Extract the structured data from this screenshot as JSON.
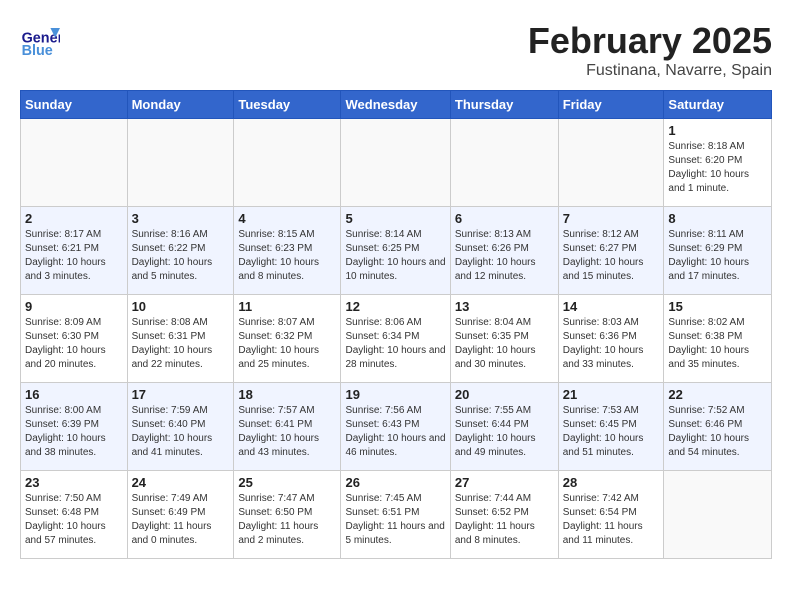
{
  "header": {
    "logo_general": "General",
    "logo_blue": "Blue",
    "month_title": "February 2025",
    "location": "Fustinana, Navarre, Spain"
  },
  "days_of_week": [
    "Sunday",
    "Monday",
    "Tuesday",
    "Wednesday",
    "Thursday",
    "Friday",
    "Saturday"
  ],
  "weeks": [
    [
      {
        "day": "",
        "info": ""
      },
      {
        "day": "",
        "info": ""
      },
      {
        "day": "",
        "info": ""
      },
      {
        "day": "",
        "info": ""
      },
      {
        "day": "",
        "info": ""
      },
      {
        "day": "",
        "info": ""
      },
      {
        "day": "1",
        "info": "Sunrise: 8:18 AM\nSunset: 6:20 PM\nDaylight: 10 hours and 1 minute."
      }
    ],
    [
      {
        "day": "2",
        "info": "Sunrise: 8:17 AM\nSunset: 6:21 PM\nDaylight: 10 hours and 3 minutes."
      },
      {
        "day": "3",
        "info": "Sunrise: 8:16 AM\nSunset: 6:22 PM\nDaylight: 10 hours and 5 minutes."
      },
      {
        "day": "4",
        "info": "Sunrise: 8:15 AM\nSunset: 6:23 PM\nDaylight: 10 hours and 8 minutes."
      },
      {
        "day": "5",
        "info": "Sunrise: 8:14 AM\nSunset: 6:25 PM\nDaylight: 10 hours and 10 minutes."
      },
      {
        "day": "6",
        "info": "Sunrise: 8:13 AM\nSunset: 6:26 PM\nDaylight: 10 hours and 12 minutes."
      },
      {
        "day": "7",
        "info": "Sunrise: 8:12 AM\nSunset: 6:27 PM\nDaylight: 10 hours and 15 minutes."
      },
      {
        "day": "8",
        "info": "Sunrise: 8:11 AM\nSunset: 6:29 PM\nDaylight: 10 hours and 17 minutes."
      }
    ],
    [
      {
        "day": "9",
        "info": "Sunrise: 8:09 AM\nSunset: 6:30 PM\nDaylight: 10 hours and 20 minutes."
      },
      {
        "day": "10",
        "info": "Sunrise: 8:08 AM\nSunset: 6:31 PM\nDaylight: 10 hours and 22 minutes."
      },
      {
        "day": "11",
        "info": "Sunrise: 8:07 AM\nSunset: 6:32 PM\nDaylight: 10 hours and 25 minutes."
      },
      {
        "day": "12",
        "info": "Sunrise: 8:06 AM\nSunset: 6:34 PM\nDaylight: 10 hours and 28 minutes."
      },
      {
        "day": "13",
        "info": "Sunrise: 8:04 AM\nSunset: 6:35 PM\nDaylight: 10 hours and 30 minutes."
      },
      {
        "day": "14",
        "info": "Sunrise: 8:03 AM\nSunset: 6:36 PM\nDaylight: 10 hours and 33 minutes."
      },
      {
        "day": "15",
        "info": "Sunrise: 8:02 AM\nSunset: 6:38 PM\nDaylight: 10 hours and 35 minutes."
      }
    ],
    [
      {
        "day": "16",
        "info": "Sunrise: 8:00 AM\nSunset: 6:39 PM\nDaylight: 10 hours and 38 minutes."
      },
      {
        "day": "17",
        "info": "Sunrise: 7:59 AM\nSunset: 6:40 PM\nDaylight: 10 hours and 41 minutes."
      },
      {
        "day": "18",
        "info": "Sunrise: 7:57 AM\nSunset: 6:41 PM\nDaylight: 10 hours and 43 minutes."
      },
      {
        "day": "19",
        "info": "Sunrise: 7:56 AM\nSunset: 6:43 PM\nDaylight: 10 hours and 46 minutes."
      },
      {
        "day": "20",
        "info": "Sunrise: 7:55 AM\nSunset: 6:44 PM\nDaylight: 10 hours and 49 minutes."
      },
      {
        "day": "21",
        "info": "Sunrise: 7:53 AM\nSunset: 6:45 PM\nDaylight: 10 hours and 51 minutes."
      },
      {
        "day": "22",
        "info": "Sunrise: 7:52 AM\nSunset: 6:46 PM\nDaylight: 10 hours and 54 minutes."
      }
    ],
    [
      {
        "day": "23",
        "info": "Sunrise: 7:50 AM\nSunset: 6:48 PM\nDaylight: 10 hours and 57 minutes."
      },
      {
        "day": "24",
        "info": "Sunrise: 7:49 AM\nSunset: 6:49 PM\nDaylight: 11 hours and 0 minutes."
      },
      {
        "day": "25",
        "info": "Sunrise: 7:47 AM\nSunset: 6:50 PM\nDaylight: 11 hours and 2 minutes."
      },
      {
        "day": "26",
        "info": "Sunrise: 7:45 AM\nSunset: 6:51 PM\nDaylight: 11 hours and 5 minutes."
      },
      {
        "day": "27",
        "info": "Sunrise: 7:44 AM\nSunset: 6:52 PM\nDaylight: 11 hours and 8 minutes."
      },
      {
        "day": "28",
        "info": "Sunrise: 7:42 AM\nSunset: 6:54 PM\nDaylight: 11 hours and 11 minutes."
      },
      {
        "day": "",
        "info": ""
      }
    ]
  ]
}
